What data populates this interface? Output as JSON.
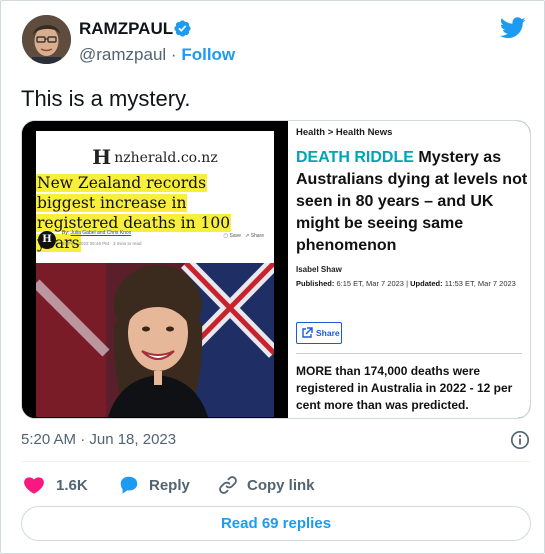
{
  "author": {
    "display_name": "RAMZPAUL",
    "handle": "@ramzpaul",
    "separator": "·",
    "follow_label": "Follow"
  },
  "tweet": {
    "text": "This is a mystery.",
    "timestamp": "5:20 AM · Jun 18, 2023"
  },
  "media": {
    "left_panel": {
      "logo_glyph": "H",
      "logo_text": "nzherald.co.nz",
      "headline": "New Zealand records biggest increase in registered deaths in 100 years",
      "byline_prefix": "By:",
      "byline_authors": "Julia Gabel and Chris Knox",
      "dateline": "19 Feb, 2023 05:46 PM · 3 mins to read",
      "save_label": "Save",
      "share_label": "Share"
    },
    "right_panel": {
      "crumb_1": "Health",
      "crumb_sep": ">",
      "crumb_2": "Health News",
      "kicker": "DEATH RIDDLE",
      "headline": "Mystery as Australians dying at levels not seen in 80 years – and UK might be seeing same phenomenon",
      "author": "Isabel Shaw",
      "published_label": "Published:",
      "published_value": "6:15 ET, Mar 7 2023",
      "updated_label": "Updated:",
      "updated_value": "11:53 ET, Mar 7 2023",
      "share_label": "Share",
      "body": "MORE than 174,000 deaths were registered in Australia in 2022 - 12 per cent more than was predicted."
    }
  },
  "actions": {
    "like_count": "1.6K",
    "reply_label": "Reply",
    "copy_link_label": "Copy link"
  },
  "read_replies_label": "Read 69 replies",
  "colors": {
    "accent": "#1d9bf0",
    "like": "#f91880",
    "highlight": "#f7ef3c",
    "kicker": "#00a5b5"
  }
}
